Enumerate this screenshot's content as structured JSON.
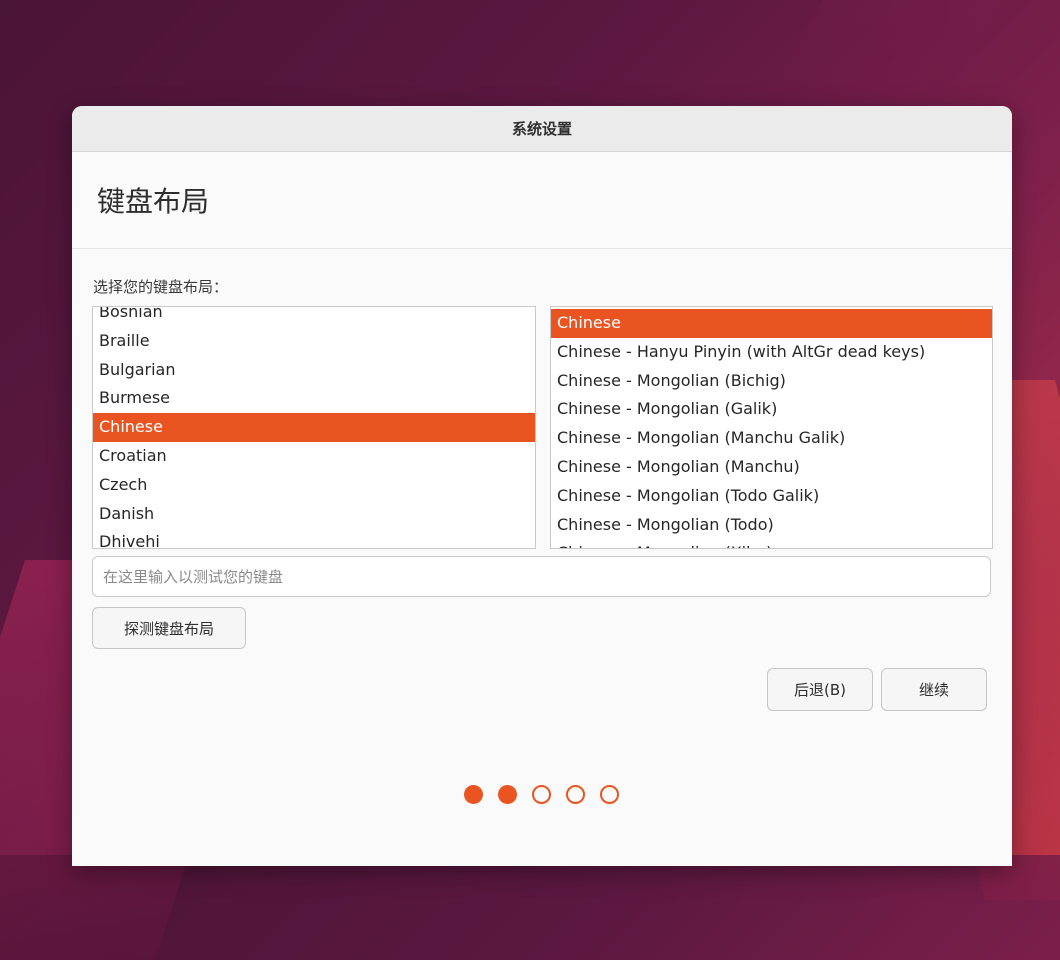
{
  "window": {
    "title": "系统设置"
  },
  "page": {
    "title": "键盘布局",
    "prompt": "选择您的键盘布局："
  },
  "layouts": {
    "items": [
      "Bosnian",
      "Braille",
      "Bulgarian",
      "Burmese",
      "Chinese",
      "Croatian",
      "Czech",
      "Danish",
      "Dhivehi"
    ],
    "selected": "Chinese"
  },
  "variants": {
    "items": [
      "Chinese",
      "Chinese - Hanyu Pinyin (with AltGr dead keys)",
      "Chinese - Mongolian (Bichig)",
      "Chinese - Mongolian (Galik)",
      "Chinese - Mongolian (Manchu Galik)",
      "Chinese - Mongolian (Manchu)",
      "Chinese - Mongolian (Todo Galik)",
      "Chinese - Mongolian (Todo)",
      "Chinese - Mongolian (Xibe)"
    ],
    "selected": "Chinese"
  },
  "test_input": {
    "placeholder": "在这里输入以测试您的键盘",
    "value": ""
  },
  "buttons": {
    "detect": "探测键盘布局",
    "back": "后退(B)",
    "continue": "继续"
  },
  "progress": {
    "total_steps": 5,
    "current_step": 2
  },
  "colors": {
    "accent": "#e95420"
  }
}
